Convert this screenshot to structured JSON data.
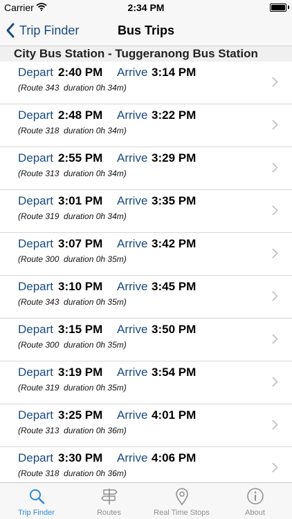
{
  "status_bar": {
    "carrier": "Carrier",
    "time": "2:34 PM"
  },
  "nav": {
    "back_label": "Trip Finder",
    "title": "Bus Trips"
  },
  "section": {
    "title": "City Bus Station - Tuggeranong Bus Station"
  },
  "labels": {
    "depart": "Depart",
    "arrive": "Arrive"
  },
  "trips": [
    {
      "depart": "2:40 PM",
      "arrive": "3:14 PM",
      "details": "(Route 343  duration 0h 34m)"
    },
    {
      "depart": "2:48 PM",
      "arrive": "3:22 PM",
      "details": "(Route 318  duration 0h 34m)"
    },
    {
      "depart": "2:55 PM",
      "arrive": "3:29 PM",
      "details": "(Route 313  duration 0h 34m)"
    },
    {
      "depart": "3:01 PM",
      "arrive": "3:35 PM",
      "details": "(Route 319  duration 0h 34m)"
    },
    {
      "depart": "3:07 PM",
      "arrive": "3:42 PM",
      "details": "(Route 300  duration 0h 35m)"
    },
    {
      "depart": "3:10 PM",
      "arrive": "3:45 PM",
      "details": "(Route 343  duration 0h 35m)"
    },
    {
      "depart": "3:15 PM",
      "arrive": "3:50 PM",
      "details": "(Route 300  duration 0h 35m)"
    },
    {
      "depart": "3:19 PM",
      "arrive": "3:54 PM",
      "details": "(Route 319  duration 0h 35m)"
    },
    {
      "depart": "3:25 PM",
      "arrive": "4:01 PM",
      "details": "(Route 313  duration 0h 36m)"
    },
    {
      "depart": "3:30 PM",
      "arrive": "4:06 PM",
      "details": "(Route 318  duration 0h 36m)"
    }
  ],
  "tabs": [
    {
      "label": "Trip Finder",
      "icon": "magnifier-icon",
      "active": true
    },
    {
      "label": "Routes",
      "icon": "signpost-icon",
      "active": false
    },
    {
      "label": "Real Time Stops",
      "icon": "map-pin-icon",
      "active": false
    },
    {
      "label": "About",
      "icon": "info-icon",
      "active": false
    }
  ],
  "colors": {
    "accent": "#1a4a7f",
    "tab_active": "#2a8bd8",
    "tab_inactive": "#8e8e93"
  }
}
